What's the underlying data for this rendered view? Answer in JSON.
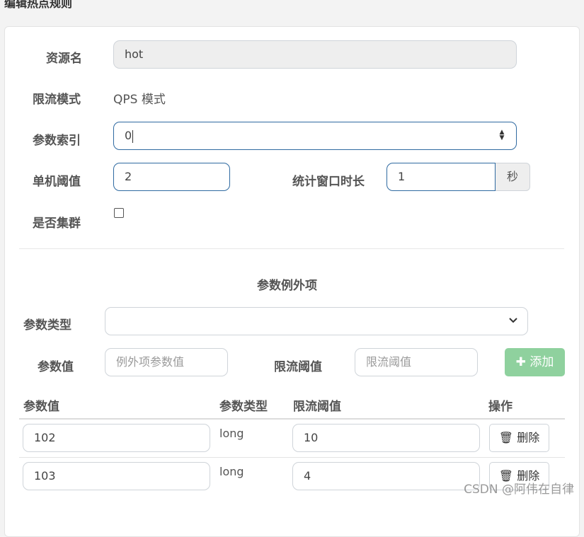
{
  "header": {
    "title": "编辑热点规则"
  },
  "form": {
    "resource_label": "资源名",
    "resource_value": "hot",
    "mode_label": "限流模式",
    "mode_value": "QPS 模式",
    "param_index_label": "参数索引",
    "param_index_value": "0",
    "threshold_label": "单机阈值",
    "threshold_value": "2",
    "window_label": "统计窗口时长",
    "window_value": "1",
    "window_unit": "秒",
    "cluster_label": "是否集群",
    "cluster_checked": false
  },
  "exceptions": {
    "section_title": "参数例外项",
    "param_type_label": "参数类型",
    "param_type_value": "",
    "param_value_label": "参数值",
    "param_value_placeholder": "例外项参数值",
    "limit_label": "限流阈值",
    "limit_placeholder": "限流阈值",
    "add_button": "添加",
    "table": {
      "headers": [
        "参数值",
        "参数类型",
        "限流阈值",
        "操作"
      ],
      "rows": [
        {
          "value": "102",
          "type": "long",
          "limit": "10",
          "action": "删除"
        },
        {
          "value": "103",
          "type": "long",
          "limit": "4",
          "action": "删除"
        }
      ]
    }
  },
  "watermark": "CSDN @阿伟在自律",
  "icons": {
    "add": "plus-icon",
    "delete": "trash-icon",
    "select": "chevron-down-icon",
    "spinner": "spinner-arrows-icon"
  },
  "colors": {
    "active_border": "#2f6aa1",
    "add_button": "#8fd19e",
    "readonly_bg": "#eeeeee"
  }
}
